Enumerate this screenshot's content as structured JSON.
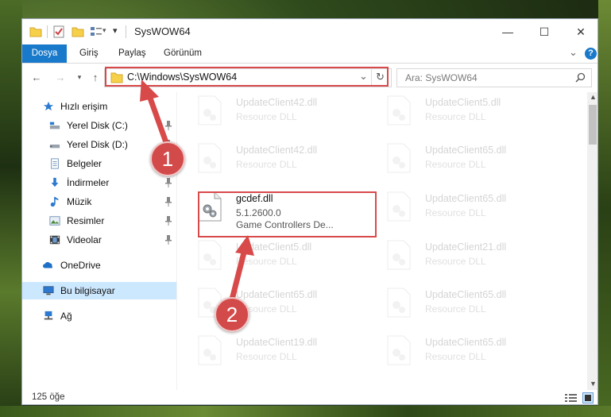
{
  "window": {
    "title": "SysWOW64",
    "minimize": "—",
    "maximize": "☐",
    "close": "✕"
  },
  "ribbon": {
    "tabs": [
      "Dosya",
      "Giriş",
      "Paylaş",
      "Görünüm"
    ],
    "expand": "⌄",
    "help": "?"
  },
  "address": {
    "path": "C:\\Windows\\SysWOW64",
    "dropdown": "⌄",
    "refresh": "↻"
  },
  "search": {
    "placeholder": "Ara: SysWOW64"
  },
  "sidebar": {
    "items": [
      {
        "label": "Hızlı erişim",
        "icon": "star-icon"
      },
      {
        "label": "Yerel Disk (C:)",
        "icon": "drive-icon",
        "pinned": true
      },
      {
        "label": "Yerel Disk (D:)",
        "icon": "drive-icon",
        "pinned": true
      },
      {
        "label": "Belgeler",
        "icon": "documents-icon",
        "pinned": true
      },
      {
        "label": "İndirmeler",
        "icon": "download-icon",
        "pinned": true
      },
      {
        "label": "Müzik",
        "icon": "music-icon",
        "pinned": true
      },
      {
        "label": "Resimler",
        "icon": "pictures-icon",
        "pinned": true
      },
      {
        "label": "Videolar",
        "icon": "videos-icon",
        "pinned": true
      },
      {
        "label": "OneDrive",
        "icon": "cloud-icon"
      },
      {
        "label": "Bu bilgisayar",
        "icon": "computer-icon",
        "selected": true
      },
      {
        "label": "Ağ",
        "icon": "network-icon"
      }
    ]
  },
  "files": [
    {
      "name": "UpdateClient42.dll",
      "line2": "Resource DLL"
    },
    {
      "name": "UpdateClient5.dll",
      "line2": "Resource DLL"
    },
    {
      "name": "UpdateClient42.dll",
      "line2": "Resource DLL"
    },
    {
      "name": "UpdateClient65.dll",
      "line2": "Resource DLL"
    },
    {
      "name": "gcdef.dll",
      "line2": "5.1.2600.0",
      "line3": "Game Controllers De...",
      "highlighted": true
    },
    {
      "name": "UpdateClient65.dll",
      "line2": "Resource DLL"
    },
    {
      "name": "UpdateClient5.dll",
      "line2": "Resource DLL"
    },
    {
      "name": "UpdateClient21.dll",
      "line2": "Resource DLL"
    },
    {
      "name": "UpdateClient65.dll",
      "line2": "Resource DLL"
    },
    {
      "name": "UpdateClient65.dll",
      "line2": "Resource DLL"
    },
    {
      "name": "UpdateClient19.dll",
      "line2": "Resource DLL"
    },
    {
      "name": "UpdateClient65.dll",
      "line2": "Resource DLL"
    }
  ],
  "status": {
    "count": "125 öğe"
  },
  "annotations": {
    "step1": "1",
    "step2": "2"
  },
  "colors": {
    "accent": "#1979ca",
    "highlight": "#d84a4a",
    "selected": "#cce8ff"
  }
}
